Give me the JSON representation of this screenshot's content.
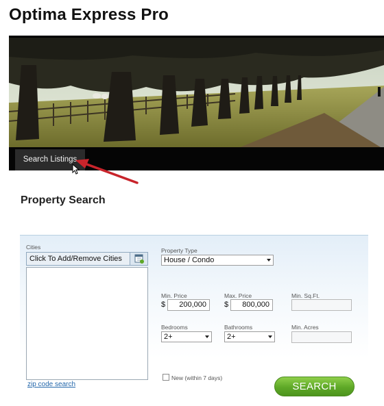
{
  "site": {
    "title": "Optima Express Pro"
  },
  "nav": {
    "items": [
      {
        "label": "Search Listings"
      }
    ]
  },
  "page": {
    "section_title": "Property Search"
  },
  "search": {
    "cities_label": "Cities",
    "cities_button": "Click To Add/Remove Cities",
    "zip_link": "zip code search",
    "property_type_label": "Property Type",
    "property_type_value": "House / Condo",
    "min_price_label": "Min. Price",
    "max_price_label": "Max. Price",
    "currency_symbol": "$",
    "min_price_value": "200,000",
    "max_price_value": "800,000",
    "min_sqft_label": "Min. Sq.Ft.",
    "bedrooms_label": "Bedrooms",
    "bedrooms_value": "2+",
    "bathrooms_label": "Bathrooms",
    "bathrooms_value": "2+",
    "min_acres_label": "Min. Acres",
    "new_label": "New (within 7 days)",
    "search_button": "SEARCH"
  },
  "colors": {
    "search_button": "#5ea827",
    "nav_bar": "#050505",
    "link": "#2266aa",
    "annotation_arrow": "#c8242b"
  },
  "icons": {
    "cities_icon": "calendar-add-icon",
    "annotation": "red-arrow-icon",
    "cursor": "mouse-cursor-icon"
  }
}
